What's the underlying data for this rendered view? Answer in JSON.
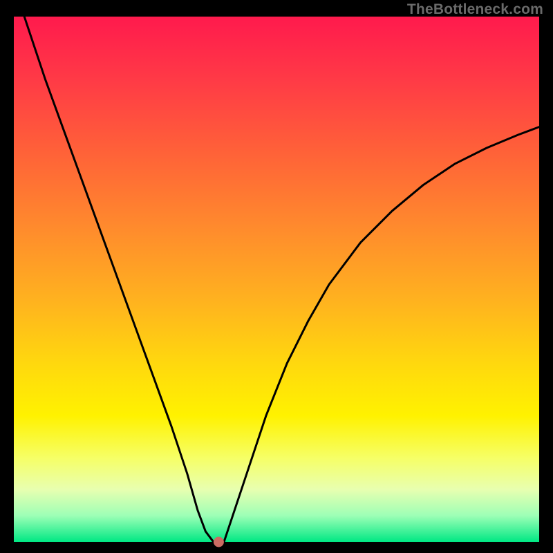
{
  "watermark": "TheBottleneck.com",
  "chart_data": {
    "type": "line",
    "title": "",
    "xlabel": "",
    "ylabel": "",
    "ylim": [
      0,
      100
    ],
    "xlim": [
      0,
      100
    ],
    "series": [
      {
        "name": "curve",
        "x": [
          2,
          6,
          10,
          14,
          18,
          22,
          26,
          30,
          33,
          35,
          36.5,
          38,
          39,
          40,
          44,
          48,
          52,
          56,
          60,
          66,
          72,
          78,
          84,
          90,
          96,
          100
        ],
        "y": [
          100,
          88,
          77,
          66,
          55,
          44,
          33,
          22,
          13,
          6,
          2,
          0,
          0,
          0,
          12,
          24,
          34,
          42,
          49,
          57,
          63,
          68,
          72,
          75,
          77.5,
          79
        ]
      }
    ],
    "marker": {
      "x": 39,
      "y": 0,
      "color": "#cc6b63",
      "r": 7
    },
    "gradient_stops": [
      {
        "pos": 0,
        "color": "#ff1a4d"
      },
      {
        "pos": 12,
        "color": "#ff3a46"
      },
      {
        "pos": 26,
        "color": "#ff6238"
      },
      {
        "pos": 40,
        "color": "#ff8a2d"
      },
      {
        "pos": 54,
        "color": "#ffb21f"
      },
      {
        "pos": 66,
        "color": "#ffd80e"
      },
      {
        "pos": 76,
        "color": "#fff200"
      },
      {
        "pos": 84,
        "color": "#f6ff66"
      },
      {
        "pos": 90,
        "color": "#e8ffb0"
      },
      {
        "pos": 95,
        "color": "#9dffb6"
      },
      {
        "pos": 100,
        "color": "#00e884"
      }
    ]
  }
}
